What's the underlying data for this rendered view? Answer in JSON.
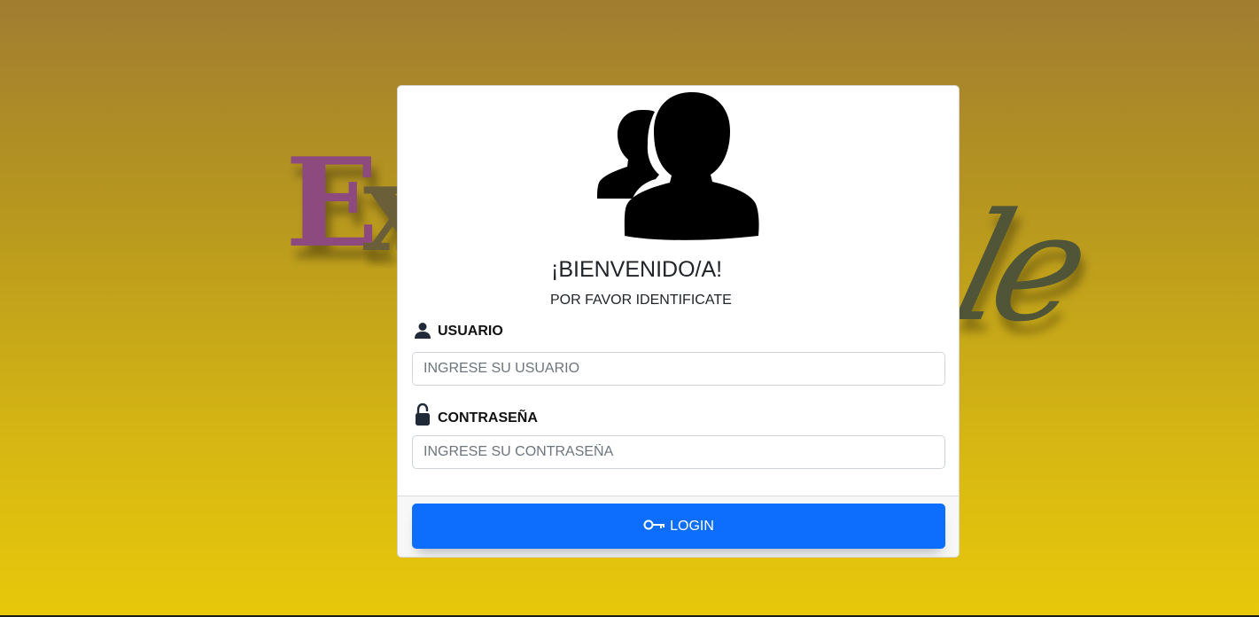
{
  "background": {
    "logo_letter": "E",
    "logo_partial": "x",
    "logo_script": "le"
  },
  "login_card": {
    "title": "¡BIENVENIDO/A!",
    "subtitle": "POR FAVOR IDENTIFICATE",
    "username": {
      "label": "USUARIO",
      "placeholder": "INGRESE SU USUARIO",
      "value": "",
      "icon": "user-icon"
    },
    "password": {
      "label": "CONTRASEÑA",
      "placeholder": "INGRESE SU CONTRASEÑA",
      "value": "",
      "icon": "lock-icon"
    },
    "login_button": {
      "label": "LOGIN",
      "icon": "key-icon"
    }
  },
  "colors": {
    "background_top": "#a07d31",
    "background_bottom": "#e8c80a",
    "primary_button": "#0d6efd",
    "logo_purple": "#8c4a7f",
    "logo_olive": "#4f5536"
  }
}
